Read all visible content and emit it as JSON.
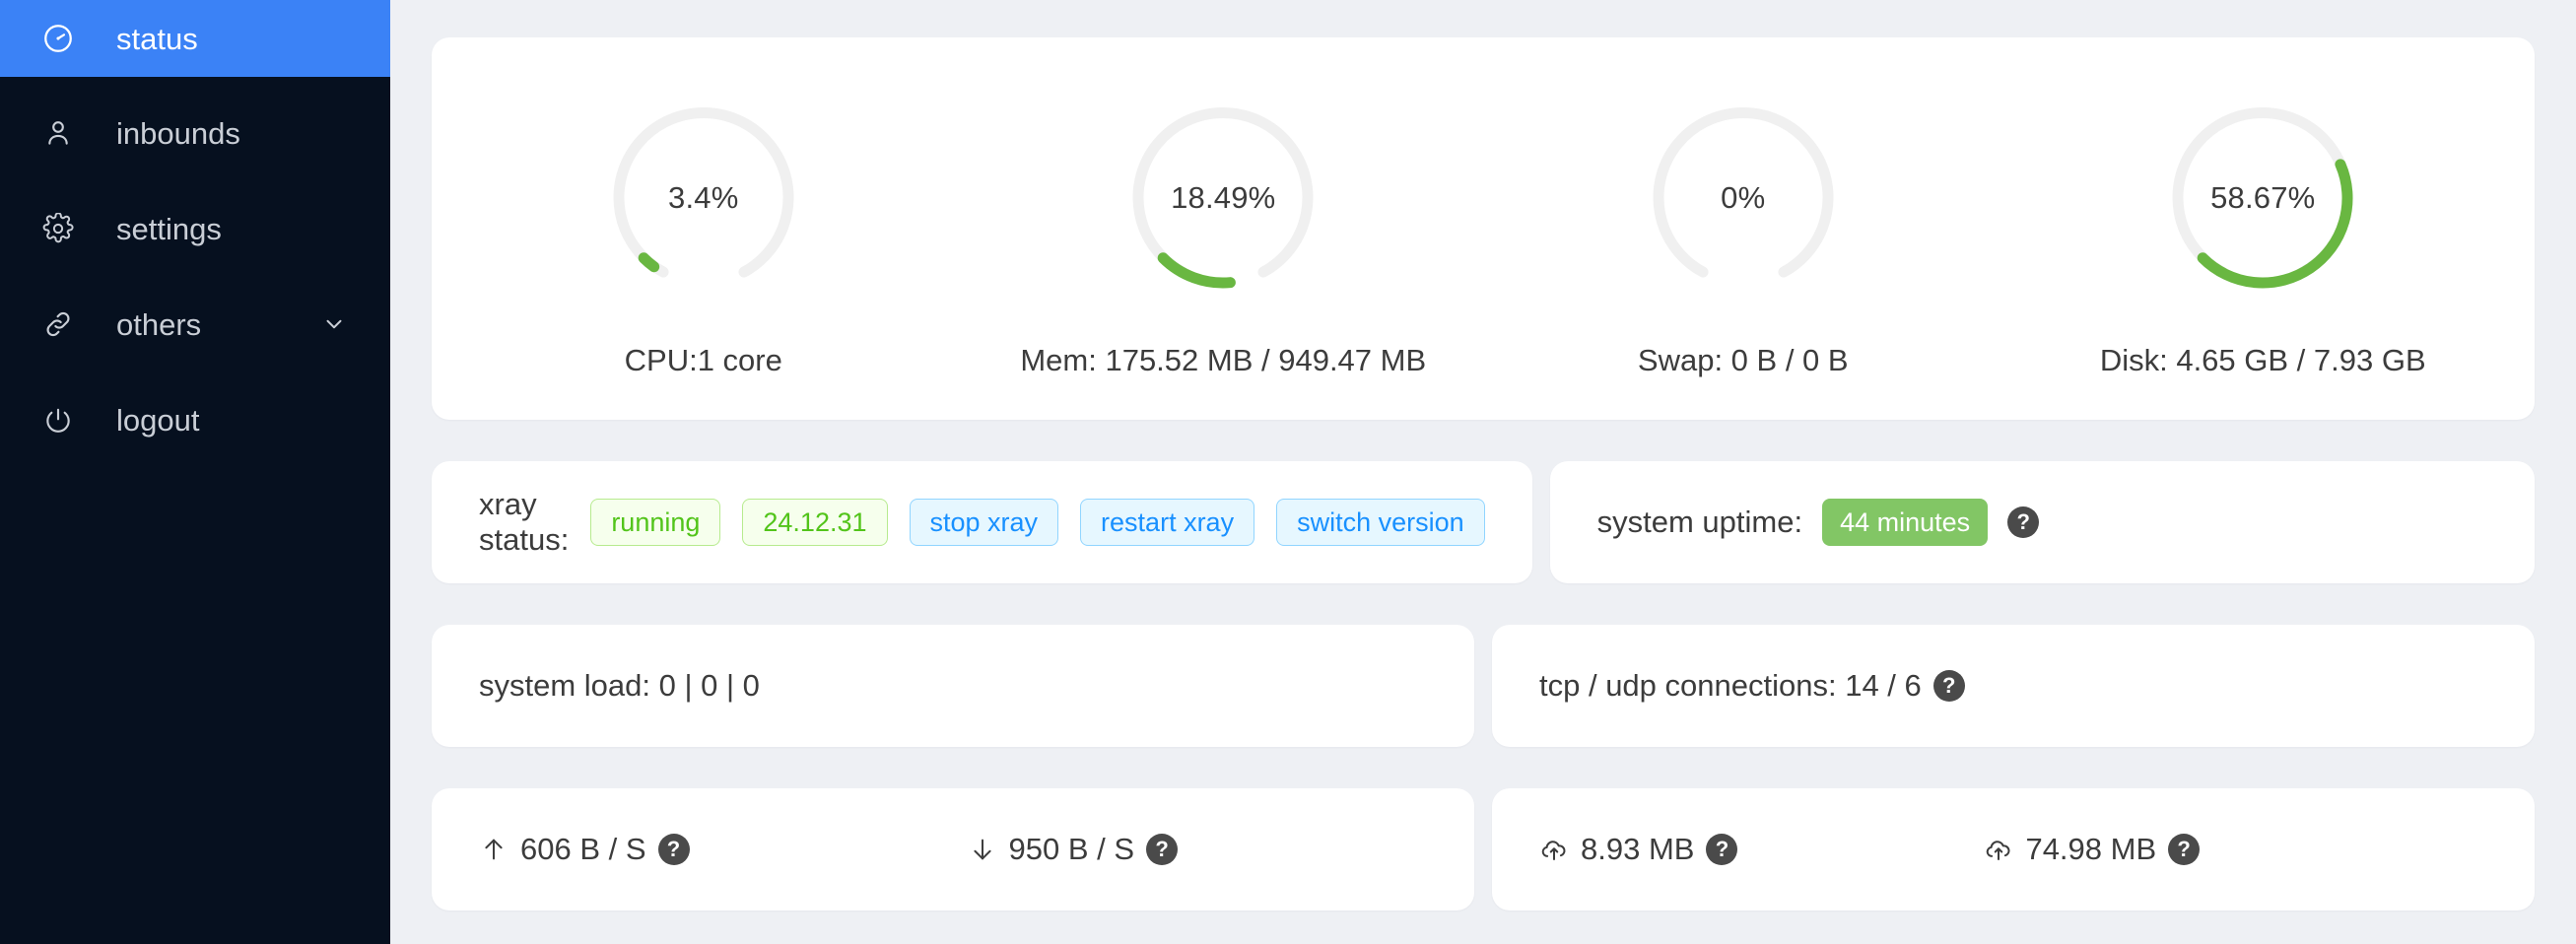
{
  "sidebar": {
    "items": [
      {
        "id": "status",
        "label": "status",
        "icon": "dashboard-icon",
        "active": true,
        "expandable": false
      },
      {
        "id": "inbounds",
        "label": "inbounds",
        "icon": "user-icon",
        "active": false,
        "expandable": false
      },
      {
        "id": "settings",
        "label": "settings",
        "icon": "gear-icon",
        "active": false,
        "expandable": false
      },
      {
        "id": "others",
        "label": "others",
        "icon": "link-icon",
        "active": false,
        "expandable": true
      },
      {
        "id": "logout",
        "label": "logout",
        "icon": "logout-icon",
        "active": false,
        "expandable": false
      }
    ],
    "background": "#06101f",
    "active_color": "#3b82f6"
  },
  "gauges": [
    {
      "id": "cpu",
      "value_text": "3.4%",
      "percent": 3.4,
      "label": "CPU:1 core"
    },
    {
      "id": "mem",
      "value_text": "18.49%",
      "percent": 18.49,
      "label": "Mem: 175.52 MB / 949.47 MB"
    },
    {
      "id": "swap",
      "value_text": "0%",
      "percent": 0,
      "label": "Swap: 0 B / 0 B"
    },
    {
      "id": "disk",
      "value_text": "58.67%",
      "percent": 58.67,
      "label": "Disk: 4.65 GB / 7.93 GB"
    }
  ],
  "gauge_colors": {
    "track": "#f0f0f0",
    "progress": "#69b741"
  },
  "xray": {
    "label": "xray status:",
    "status_pill": "running",
    "version_pill": "24.12.31",
    "stop_button": "stop xray",
    "restart_button": "restart xray",
    "switch_button": "switch version"
  },
  "uptime": {
    "label": "system uptime:",
    "value": "44 minutes",
    "help": "?"
  },
  "system_load": {
    "text": "system load: 0 | 0 | 0"
  },
  "connections": {
    "text": "tcp / udp connections: 14 / 6",
    "help": "?"
  },
  "speeds": {
    "upload": {
      "icon": "arrow-up-icon",
      "text": "606 B / S",
      "help": "?"
    },
    "download": {
      "icon": "arrow-down-icon",
      "text": "950 B / S",
      "help": "?"
    }
  },
  "totals": {
    "sent": {
      "icon": "cloud-upload-icon",
      "text": "8.93 MB",
      "help": "?"
    },
    "received": {
      "icon": "cloud-upload-icon",
      "text": "74.98 MB",
      "help": "?"
    }
  }
}
